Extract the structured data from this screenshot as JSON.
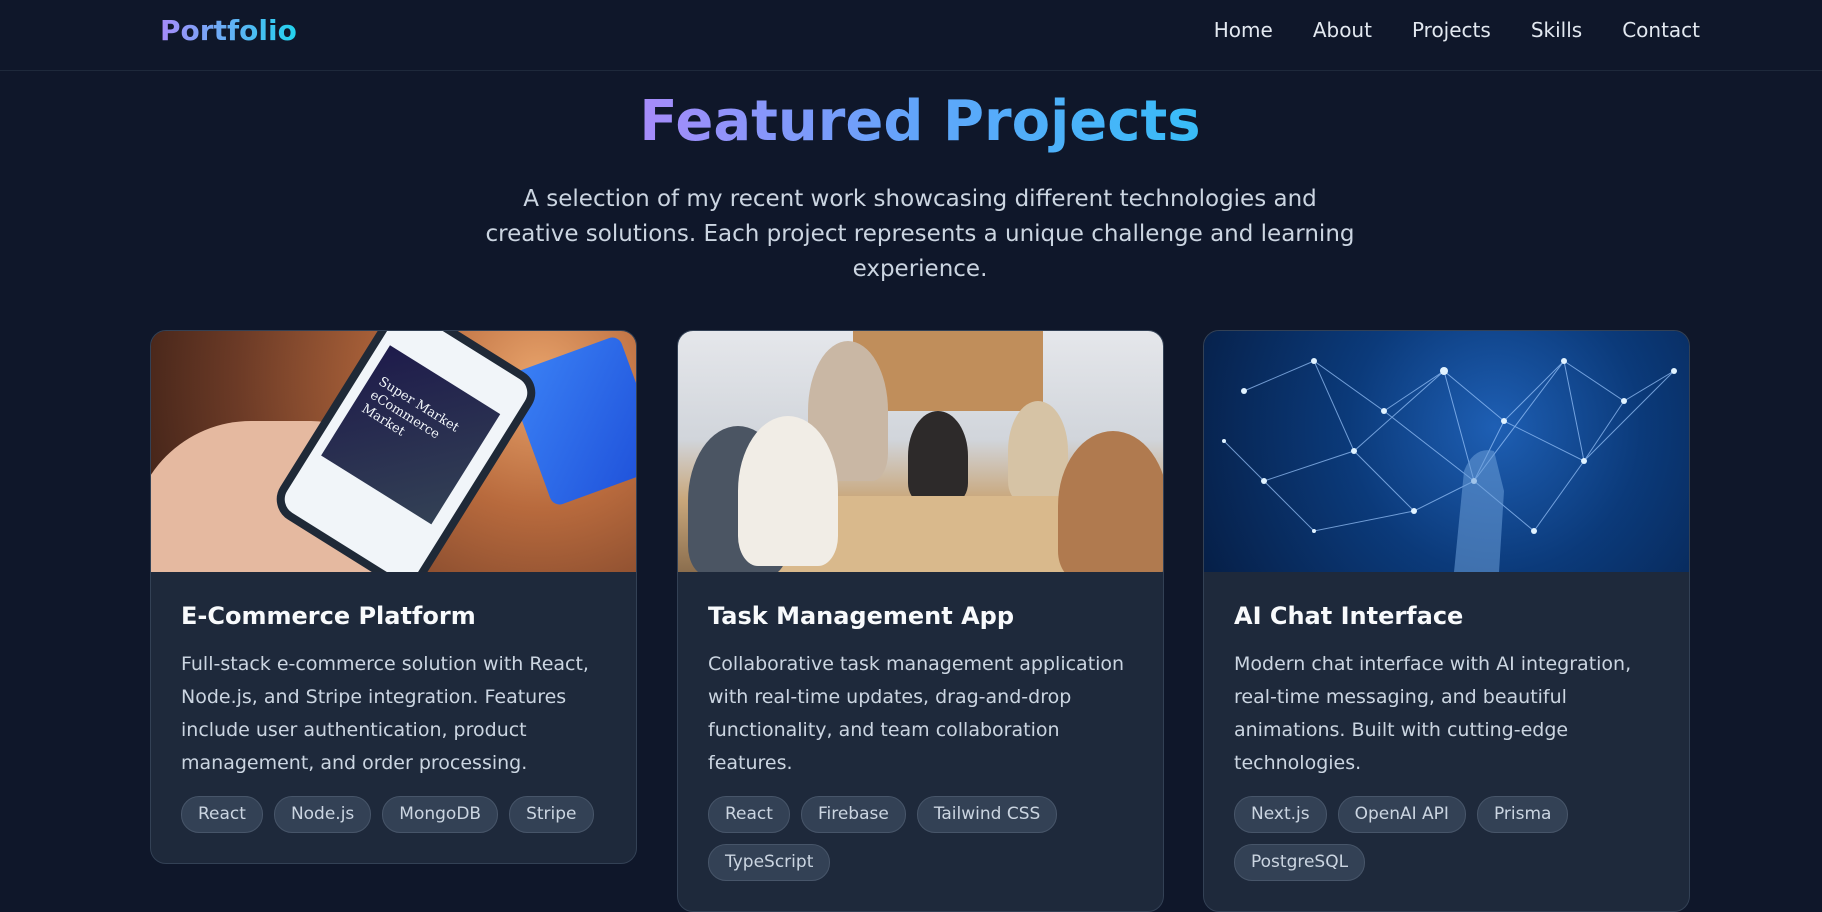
{
  "nav": {
    "logo": "Portfolio",
    "links": [
      "Home",
      "About",
      "Projects",
      "Skills",
      "Contact"
    ]
  },
  "hero": {
    "title": "Featured Projects",
    "subtitle": "A selection of my recent work showcasing different technologies and creative solutions. Each project represents a unique challenge and learning experience."
  },
  "projects": [
    {
      "title": "E-Commerce Platform",
      "description": "Full-stack e-commerce solution with React, Node.js, and Stripe integration. Features include user authentication, product management, and order processing.",
      "tags": [
        "React",
        "Node.js",
        "MongoDB",
        "Stripe"
      ],
      "phone_screen_text": "Super Market eCommerce Market"
    },
    {
      "title": "Task Management App",
      "description": "Collaborative task management application with real-time updates, drag-and-drop functionality, and team collaboration features.",
      "tags": [
        "React",
        "Firebase",
        "Tailwind CSS",
        "TypeScript"
      ]
    },
    {
      "title": "AI Chat Interface",
      "description": "Modern chat interface with AI integration, real-time messaging, and beautiful animations. Built with cutting-edge technologies.",
      "tags": [
        "Next.js",
        "OpenAI API",
        "Prisma",
        "PostgreSQL"
      ]
    }
  ],
  "colors": {
    "background": "#0f172a",
    "card": "#1e293b",
    "tag": "#334155",
    "accent_start": "#a78bfa",
    "accent_end": "#22d3ee"
  }
}
